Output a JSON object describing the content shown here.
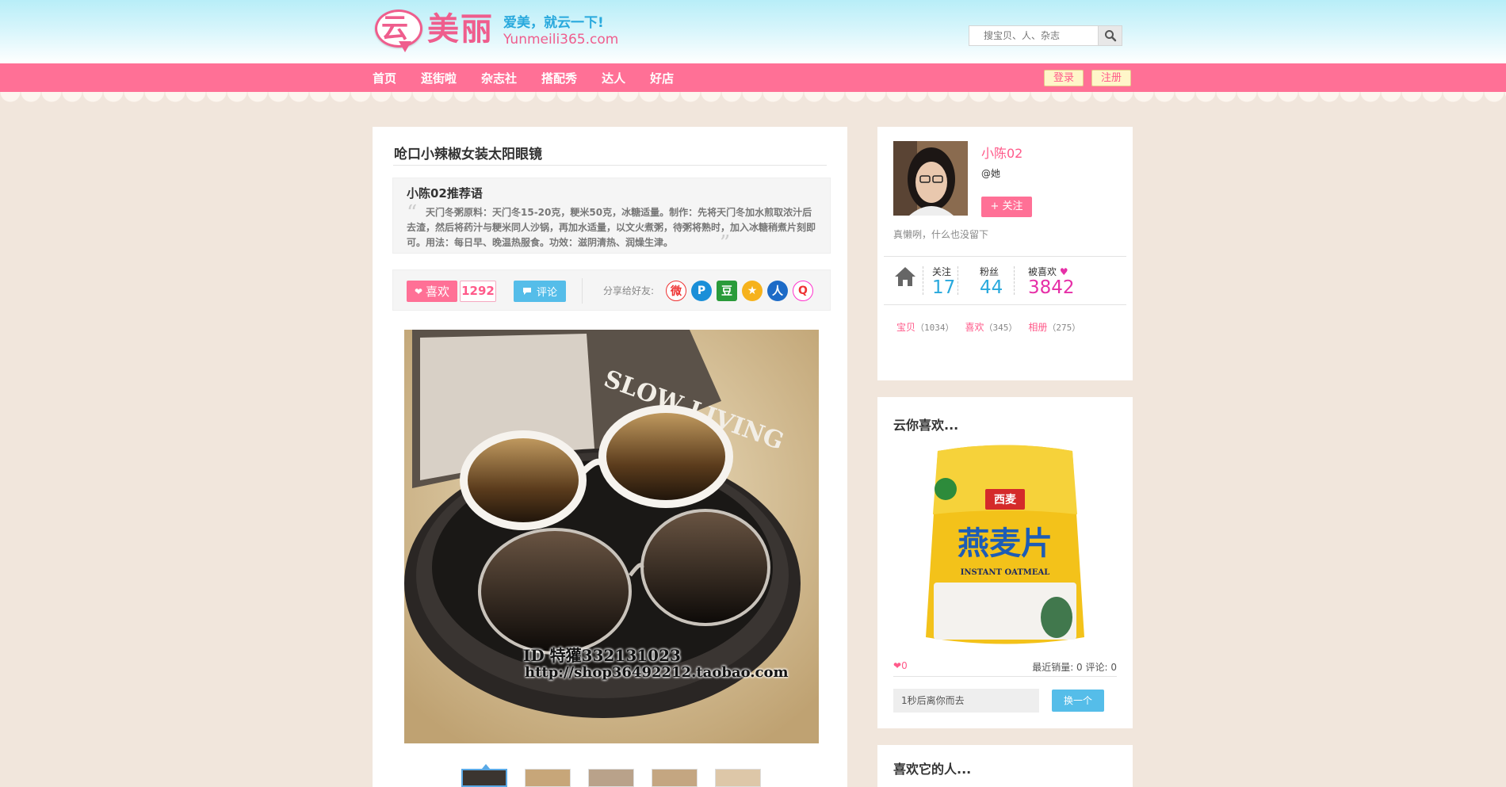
{
  "site": {
    "logo_char": "云",
    "logo_name": "美丽",
    "slogan": "爱美，就云一下!",
    "url": "Yunmeili365.com"
  },
  "search": {
    "placeholder": "搜宝贝、人、杂志"
  },
  "nav": {
    "items": [
      "首页",
      "逛街啦",
      "杂志社",
      "搭配秀",
      "达人",
      "好店"
    ],
    "login": "登录",
    "register": "注册"
  },
  "item": {
    "title": "呛口小辣椒女装太阳眼镜",
    "rec_title": "小陈02推荐语",
    "rec_text": "天门冬粥原料：天门冬15-20克，粳米50克，冰糖适量。制作：先将天门冬加水煎取浓汁后去渣，然后将药汁与粳米同人沙锅，再加水适量，以文火煮粥，待粥将熟时，加入冰糖稍煮片刻即可。用法：每日早、晚温热服食。功效：滋阴清热、润燥生津。",
    "like_label": "喜欢",
    "like_count": "1292",
    "comment_label": "评论",
    "share_label": "分享给好友:",
    "share_icons": [
      "weibo-icon",
      "qq-icon",
      "douban-icon",
      "kaixin-icon",
      "renren-icon",
      "tqq-icon"
    ],
    "photo_text_1": "ID 特獾332131023",
    "photo_text_2": "http://shop36492212.taobao.com"
  },
  "profile": {
    "name": "小陈02",
    "gender": "@她",
    "follow_label": "+ 关注",
    "bio": "真懒咧，什么也没留下",
    "stats": [
      {
        "label": "关注",
        "value": "17",
        "color": "#29a9dd"
      },
      {
        "label": "粉丝",
        "value": "44",
        "color": "#29a9dd"
      },
      {
        "label": "被喜欢",
        "value": "3842",
        "color": "#e62fa7"
      }
    ],
    "counts": [
      {
        "label": "宝贝",
        "num": "（1034）"
      },
      {
        "label": "喜欢",
        "num": "（345）"
      },
      {
        "label": "相册",
        "num": "（275）"
      }
    ]
  },
  "suggest": {
    "title": "云你喜欢...",
    "likes": "0",
    "meta": "最近销量: 0  评论: 0",
    "timer": "1秒后离你而去",
    "change_label": "换一个",
    "product_brand": "西麦",
    "product_name": "燕麦片",
    "product_en": "INSTANT OATMEAL"
  },
  "likers": {
    "title": "喜欢它的人..."
  },
  "colors": {
    "pink": "#ff7096",
    "blue": "#55bde9",
    "magenta": "#e62fa7"
  }
}
